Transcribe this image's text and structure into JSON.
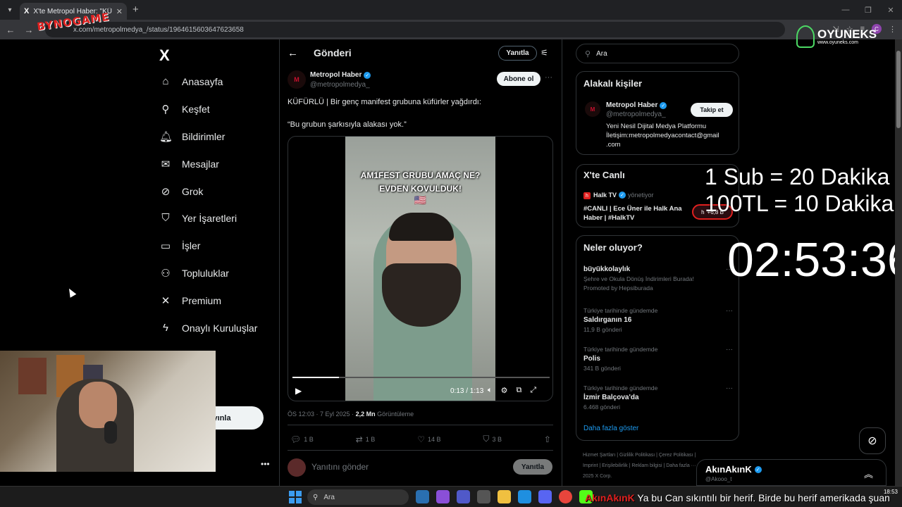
{
  "browser": {
    "tab_title": "X'te Metropol Haber: \"KÜFÜRLÜ",
    "url": "x.com/metropolmedya_/status/1964615603647623658",
    "tab_favicon": "X",
    "profile_letter": "C"
  },
  "overlays": {
    "top_left_logo": "BYNOGAME",
    "top_right_brand": "OYUNEKS",
    "top_right_url": "www.oyuneks.com",
    "stream_line1": "1 Sub  = 20 Dakika",
    "stream_line2": "100TL = 10 Dakika",
    "timer": "02:53:36"
  },
  "sidebar": {
    "logo": "X",
    "items": [
      {
        "label": "Anasayfa",
        "icon": "home-icon"
      },
      {
        "label": "Keşfet",
        "icon": "search-icon"
      },
      {
        "label": "Bildirimler",
        "icon": "bell-icon"
      },
      {
        "label": "Mesajlar",
        "icon": "mail-icon"
      },
      {
        "label": "Grok",
        "icon": "grok-icon"
      },
      {
        "label": "Yer İşaretleri",
        "icon": "bookmark-icon"
      },
      {
        "label": "İşler",
        "icon": "briefcase-icon"
      },
      {
        "label": "Topluluklar",
        "icon": "people-icon"
      },
      {
        "label": "Premium",
        "icon": "x-icon"
      },
      {
        "label": "Onaylı Kuruluşlar",
        "icon": "lightning-icon"
      },
      {
        "label": "zla",
        "icon": "more-icon"
      }
    ],
    "post_button": "ayınla"
  },
  "header": {
    "title": "Gönderi",
    "reply_button": "Yanıtla"
  },
  "post": {
    "author": "Metropol Haber",
    "handle": "@metropolmedya_",
    "subscribe_button": "Abone ol",
    "text1": "KÜFÜRLÜ | Bir genç manifest grubuna küfürler yağdırdı:",
    "text2": "“Bu grubun şarkısıyla alakası yok.”",
    "video": {
      "caption_line1": "AM1FEST GRUBU AMAÇ NE?",
      "caption_line2": "EVDEN KOVULDUK!",
      "flag": "🇺🇸",
      "time": "0:13 / 1:13",
      "progress": 0.18
    },
    "meta_time": "ÖS 12:03 · 7 Eyl 2025 · ",
    "meta_views": "2,2 Mn",
    "meta_views_label": " Görüntüleme",
    "stats": {
      "replies": "1 B",
      "reposts": "1 B",
      "likes": "14 B",
      "bookmarks": "3 B"
    },
    "reply_placeholder": "Yanıtını gönder",
    "reply_button": "Yanıtla"
  },
  "right": {
    "search_placeholder": "Ara",
    "related_title": "Alakalı kişiler",
    "related": {
      "name": "Metropol Haber",
      "handle": "@metropolmedya_",
      "follow": "Takip et",
      "bio": "Yeni Nesil Dijital Medya Platformu İletişim:metropolmedyacontact@gmail .com"
    },
    "live_title": "X'te Canlı",
    "live": {
      "host": "Halk TV",
      "role": "yönetiyor",
      "title": "#CANLI | Ece Üner ile Halk Ana Haber | #HalkTV",
      "count": "+6,8 B"
    },
    "trends_title": "Neler oluyor?",
    "trends": [
      {
        "context": "",
        "name": "büyükkolaylık",
        "sub": "Şehre ve Okula Dönüş İndirimleri Burada!",
        "promo": "Promoted by Hepsiburada"
      },
      {
        "context": "Türkiye tarihinde gündemde",
        "name": "Saldırganın 16",
        "sub": "11,9 B gönderi"
      },
      {
        "context": "Türkiye tarihinde gündemde",
        "name": "Polis",
        "sub": "341 B gönderi"
      },
      {
        "context": "Türkiye tarihinde gündemde",
        "name": "İzmir Balçova'da",
        "sub": "6.468 gönderi"
      }
    ],
    "show_more": "Daha fazla göster",
    "footer": "Hizmet Şartları  |  Gizlilik Politikası  |  Çerez Politikası  |  Imprint  |  Erişilebilirlik  |  Reklam bilgisi  |  Daha fazla ···  © 2025 X Corp."
  },
  "chat": {
    "name": "AkınAkınK",
    "handle": "@Akooo_t"
  },
  "taskbar": {
    "search": "Ara",
    "ticker_name": "AkınAkınK",
    "ticker_text": " Ya bu Can sıkıntılı bir herif. Birde bu herif amerikada şuan",
    "time": "18:53"
  }
}
